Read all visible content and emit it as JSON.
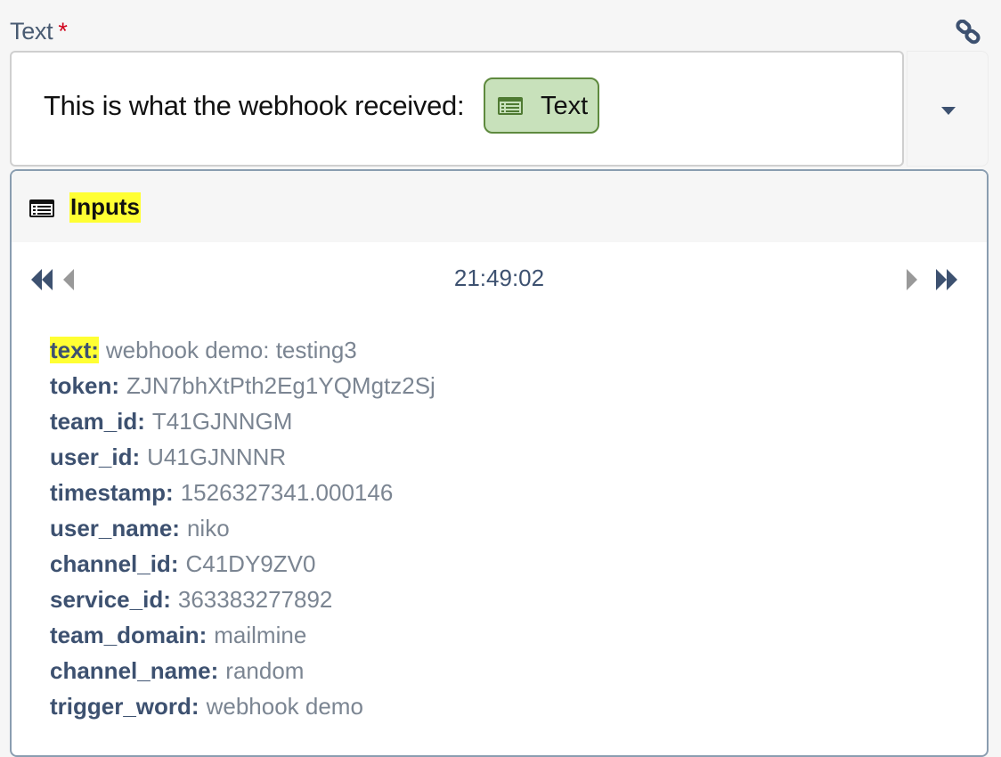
{
  "field": {
    "label": "Text",
    "required_marker": "*",
    "link_icon": "link-icon"
  },
  "input": {
    "prefix_text": "This is what the webhook received:",
    "token": {
      "label": "Text",
      "icon": "list-icon",
      "bg_color": "#c8e1bb",
      "border_color": "#5e8a3e"
    },
    "dropdown_icon": "caret-down-icon"
  },
  "panel": {
    "title": "Inputs",
    "title_icon": "list-icon",
    "highlight_color": "#ffff33",
    "navigation": {
      "first_icon": "double-chevron-left-icon",
      "prev_icon": "chevron-left-icon",
      "next_icon": "chevron-right-icon",
      "last_icon": "double-chevron-right-icon",
      "timestamp": "21:49:02"
    },
    "fields": [
      {
        "key": "text:",
        "value": "webhook demo: testing3",
        "highlighted": true
      },
      {
        "key": "token:",
        "value": "ZJN7bhXtPth2Eg1YQMgtz2Sj"
      },
      {
        "key": "team_id:",
        "value": "T41GJNNGM"
      },
      {
        "key": "user_id:",
        "value": "U41GJNNNR"
      },
      {
        "key": "timestamp:",
        "value": "1526327341.000146"
      },
      {
        "key": "user_name:",
        "value": "niko"
      },
      {
        "key": "channel_id:",
        "value": "C41DY9ZV0"
      },
      {
        "key": "service_id:",
        "value": "363383277892"
      },
      {
        "key": "team_domain:",
        "value": "mailmine"
      },
      {
        "key": "channel_name:",
        "value": "random"
      },
      {
        "key": "trigger_word:",
        "value": "webhook demo"
      }
    ]
  }
}
